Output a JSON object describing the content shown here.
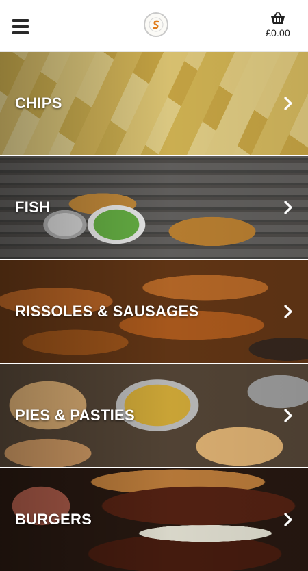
{
  "header": {
    "menu_icon": "hamburger-menu-icon",
    "logo_icon": "shop-logo",
    "cart_icon": "basket-icon",
    "cart_total": "£0.00"
  },
  "categories": [
    {
      "label": "CHIPS"
    },
    {
      "label": "FISH"
    },
    {
      "label": "RISSOLES & SAUSAGES"
    },
    {
      "label": "PIES & PASTIES"
    },
    {
      "label": "BURGERS"
    }
  ],
  "colors": {
    "header_bg": "#ffffff",
    "label_text": "#ffffff",
    "logo_accent": "#e07b1a"
  }
}
